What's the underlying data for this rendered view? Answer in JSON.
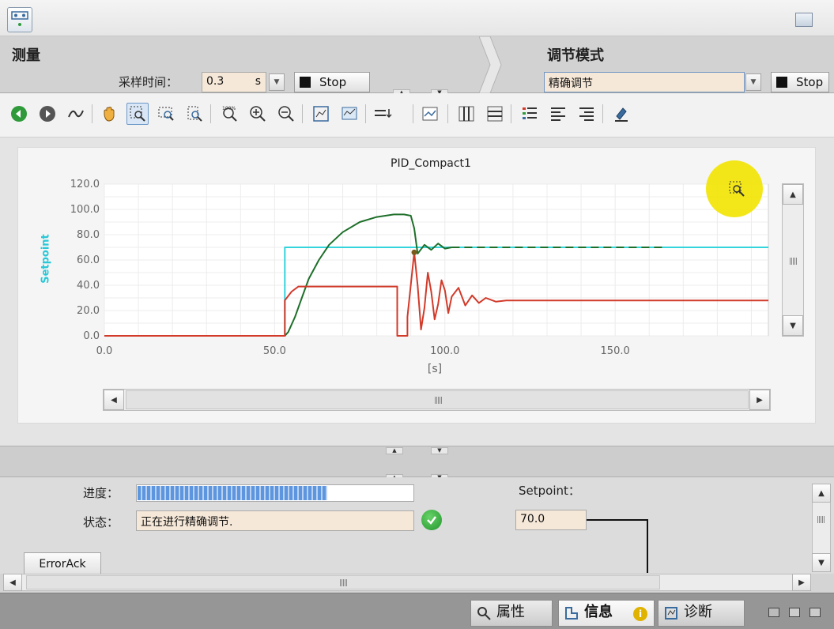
{
  "section_left": {
    "title": "测量",
    "sample_label": "采样时间：",
    "sample_value": "0.3",
    "sample_unit": "s",
    "stop_label": "Stop"
  },
  "section_right": {
    "title": "调节模式",
    "mode_value": "精确调节",
    "stop_label": "Stop"
  },
  "toolbar": {
    "icons": [
      "back-icon",
      "forward-icon",
      "curve-icon",
      "pan-hand-icon",
      "zoom-box-icon",
      "zoom-x-icon",
      "zoom-y-icon",
      "reset-zoom-icon",
      "zoom-in-icon",
      "zoom-out-icon",
      "fit-icon",
      "scale-icon",
      "export-icon",
      "trend-icon",
      "vertical-ruler-icon",
      "horizontal-ruler-icon",
      "legend-color-icon",
      "align-left-icon",
      "align-right-icon",
      "pen-icon"
    ]
  },
  "chart_data": {
    "type": "line",
    "title": "PID_Compact1",
    "xlabel": "[s]",
    "ylabel": "Setpoint",
    "xlim": [
      0,
      195
    ],
    "ylim": [
      0,
      120
    ],
    "x_ticks": [
      "0.0",
      "50.0",
      "100.0",
      "150.0"
    ],
    "y_ticks": [
      "0.0",
      "20.0",
      "40.0",
      "60.0",
      "80.0",
      "100.0",
      "120.0"
    ],
    "grid": true,
    "series": [
      {
        "color": "#33d4dc",
        "style": "solid",
        "x": [
          0,
          53,
          53,
          195
        ],
        "y": [
          0,
          0,
          70,
          70
        ]
      },
      {
        "color": "#1e6f2a",
        "style": "solid",
        "x": [
          0,
          53,
          54,
          56,
          58,
          60,
          63,
          66,
          70,
          75,
          80,
          85,
          88,
          90,
          91,
          92,
          94,
          96,
          98,
          100,
          102
        ],
        "y": [
          0,
          0,
          3,
          15,
          30,
          45,
          60,
          72,
          82,
          90,
          94,
          96,
          96,
          95,
          85,
          65,
          72,
          68,
          73,
          69,
          70
        ]
      },
      {
        "color": "#1e6f2a",
        "style": "dashed",
        "x": [
          102,
          165
        ],
        "y": [
          70,
          70
        ]
      },
      {
        "color": "#d23a2a",
        "style": "solid",
        "x": [
          0,
          53,
          53,
          55,
          57,
          85,
          85,
          86,
          86,
          89,
          89,
          91,
          92,
          93,
          94,
          95,
          96,
          97,
          98,
          99,
          100,
          101,
          102,
          104,
          106,
          108,
          110,
          112,
          115,
          118,
          122,
          195
        ],
        "y": [
          0,
          0,
          28,
          35,
          39,
          39,
          39,
          39,
          0,
          0,
          15,
          66,
          40,
          5,
          22,
          50,
          35,
          13,
          25,
          44,
          36,
          18,
          31,
          38,
          24,
          32,
          26,
          30,
          27,
          28,
          28,
          28
        ]
      }
    ]
  },
  "bottom": {
    "progress_label": "进度：",
    "progress_fraction": 0.69,
    "status_label": "状态：",
    "status_value": "正在进行精确调节.",
    "setpoint_label": "Setpoint：",
    "setpoint_value": "70.0",
    "errorack_label": "ErrorAck"
  },
  "status_bar": {
    "tabs": [
      {
        "label": "属性",
        "icon": "properties-icon"
      },
      {
        "label": "信息",
        "icon": "info-icon"
      },
      {
        "label": "诊断",
        "icon": "diagnostics-icon"
      }
    ]
  },
  "colors": {
    "setpoint": "#33d4dc",
    "input": "#1e6f2a",
    "output": "#d23a2a",
    "highlight": "#f2e400"
  }
}
